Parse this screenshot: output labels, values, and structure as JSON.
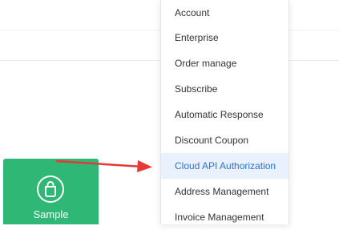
{
  "colors": {
    "tile_green": "#2fb776",
    "active_bg": "#e8f1fd",
    "active_text": "#2f6fd8",
    "arrow_red": "#e53935",
    "menu_text": "#333333"
  },
  "menu": {
    "items": [
      {
        "label": "Account",
        "active": false
      },
      {
        "label": "Enterprise",
        "active": false
      },
      {
        "label": "Order manage",
        "active": false
      },
      {
        "label": "Subscribe",
        "active": false
      },
      {
        "label": "Automatic Response",
        "active": false
      },
      {
        "label": "Discount Coupon",
        "active": false
      },
      {
        "label": "Cloud API Authorization",
        "active": true
      },
      {
        "label": "Address Management",
        "active": false
      },
      {
        "label": "Invoice Management",
        "active": false
      }
    ]
  },
  "tile": {
    "label": "Sample",
    "icon": "shopping-bag-icon"
  },
  "annotation": {
    "icon": "red-arrow-icon"
  }
}
